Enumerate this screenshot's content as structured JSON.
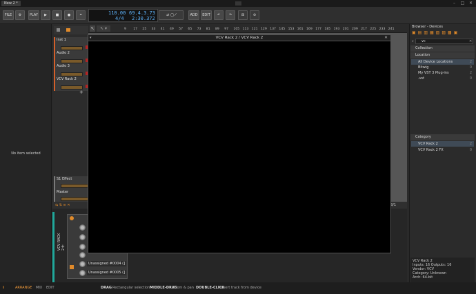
{
  "titlebar": {
    "tab": "New 2 *",
    "min": "–",
    "max": "□",
    "close": "✕"
  },
  "toolbar": {
    "file": "FILE",
    "play": "PLAY",
    "add": "ADD",
    "edit": "EDIT",
    "tempo": "110.00",
    "signature": "4/4",
    "position": "69.4.3.73",
    "time": "2:30.372"
  },
  "left_panel": {
    "empty": "No item selected"
  },
  "tracks": [
    {
      "name": "Inst 1"
    },
    {
      "name": "Audio 2"
    },
    {
      "name": "Audio 3"
    },
    {
      "name": "VCV Rack 2"
    }
  ],
  "effect_track": "S1 Effect",
  "master_track": "Master",
  "ruler_ticks": [
    "9",
    "17",
    "25",
    "33",
    "41",
    "49",
    "57",
    "65",
    "73",
    "81",
    "89",
    "97",
    "105",
    "113",
    "121",
    "129",
    "137",
    "145",
    "153",
    "161",
    "169",
    "177",
    "185",
    "193",
    "201",
    "209",
    "217",
    "225",
    "233",
    "241"
  ],
  "zoom": "8/1",
  "vcv_window": {
    "title": "VCV Rack 2 / VCV Rack 2"
  },
  "device": {
    "label": "VCV RACK 2",
    "slots": [
      "Unassigned #0004 (]",
      "Unassigned #0005 (]"
    ]
  },
  "browser": {
    "title": "Browser - Devices",
    "search": "vc",
    "sections": {
      "collection": "Collection",
      "location": "Location",
      "category": "Category"
    },
    "locations": [
      {
        "name": "All Device Locations",
        "count": "2"
      },
      {
        "name": "Bitwig",
        "count": "0"
      },
      {
        "name": "My VST 3 Plug-ins",
        "count": "2"
      },
      {
        "name": ".vst",
        "count": "0"
      }
    ],
    "results": [
      {
        "name": "VCV Rack 2",
        "count": "2"
      },
      {
        "name": "VCV Rack 2 FX",
        "count": "0"
      }
    ],
    "info": {
      "name": "VCV Rack 2",
      "io": "Inputs: 16   Outputs: 16",
      "vendor": "Vendor: VCV",
      "category": "Category: Unknown",
      "arch": "Arch: 64-bit"
    }
  },
  "statusbar": {
    "arrange": "ARRANGE",
    "mix": "MIX",
    "edit": "EDIT",
    "drag": "DRAG",
    "drag_desc": "Rectangular selection",
    "middle_drag": "MIDDLE-DRAG",
    "middle_drag_desc": "Zoom & pan",
    "double_click": "DOUBLE-CLICK",
    "double_click_desc": "Insert track from device"
  }
}
